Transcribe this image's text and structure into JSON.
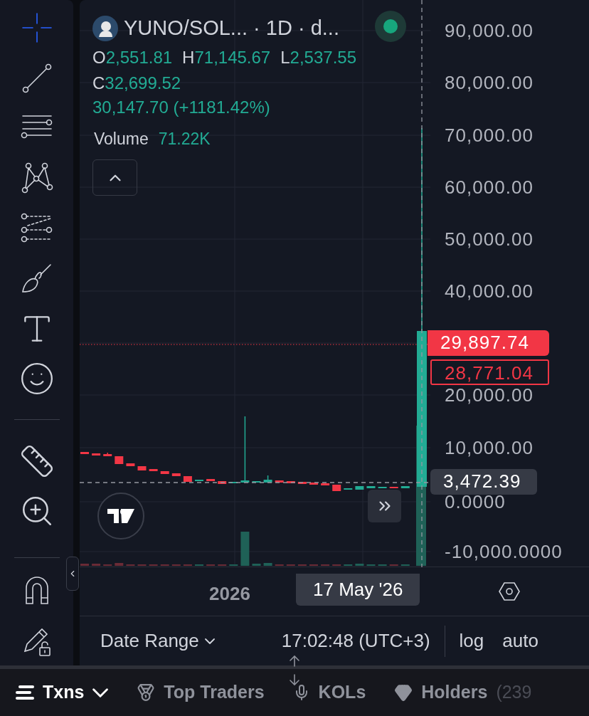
{
  "toolbar": {
    "groups": [
      [
        {
          "kind": "crosshair",
          "selected": true
        },
        {
          "kind": "trend-line",
          "selected": false
        },
        {
          "kind": "fib",
          "selected": false
        },
        {
          "kind": "pattern",
          "selected": false
        },
        {
          "kind": "forecast",
          "selected": false
        },
        {
          "kind": "brush",
          "selected": false
        },
        {
          "kind": "text",
          "selected": false
        },
        {
          "kind": "emoji",
          "selected": false
        }
      ],
      [
        {
          "kind": "ruler",
          "selected": false
        },
        {
          "kind": "zoom",
          "selected": false
        }
      ],
      [
        {
          "kind": "magnet",
          "selected": false
        },
        {
          "kind": "lock-drawing",
          "selected": false
        }
      ]
    ]
  },
  "legend": {
    "title": "YUNO/SOL... · 1D · d...",
    "ohlc": [
      {
        "key": "O",
        "value": "2,551.81"
      },
      {
        "key": "H",
        "value": "71,145.67"
      },
      {
        "key": "L",
        "value": "2,537.55"
      },
      {
        "key": "C",
        "value": "32,699.52"
      }
    ],
    "change": "30,147.70 (+1181.42%)",
    "volume": {
      "label": "Volume",
      "value": "71.22K"
    }
  },
  "price_axis": {
    "labels": [
      "90,000.00",
      "80,000.00",
      "70,000.00",
      "60,000.00",
      "50,000.00",
      "40,000.00",
      "20,000.00",
      "10,000.00",
      "0.0000",
      "-10,000.0000"
    ],
    "tags": [
      {
        "kind": "filled",
        "text": "29,897.74"
      },
      {
        "kind": "outline",
        "text": "28,771.04"
      },
      {
        "kind": "crosshair",
        "text": "3,472.39"
      }
    ]
  },
  "time_axis": {
    "label": "2026",
    "crosshair_date": "17 May '26"
  },
  "footer": {
    "date_range": "Date Range",
    "clock": "17:02:48 (UTC+3)",
    "log": "log",
    "auto": "auto"
  },
  "tabs": [
    {
      "kind": "menu",
      "label": "Txns",
      "selected": true
    },
    {
      "kind": "medal",
      "label": "Top Traders",
      "selected": false
    },
    {
      "kind": "mic",
      "label": "KOLs",
      "selected": false
    },
    {
      "kind": "gem",
      "label": "Holders",
      "count": "(239",
      "selected": false
    }
  ]
}
